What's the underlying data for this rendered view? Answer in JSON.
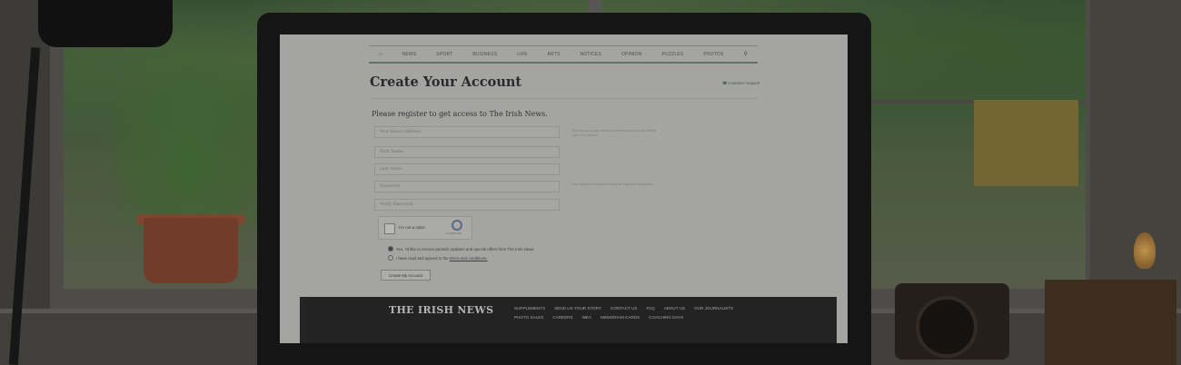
{
  "nav": {
    "items": [
      "NEWS",
      "SPORT",
      "BUSINESS",
      "LIFE",
      "ARTS",
      "NOTICES",
      "OPINION",
      "PUZZLES",
      "PHOTOS"
    ],
    "home_icon": "home-icon",
    "search_icon": "search-icon"
  },
  "header": {
    "title": "Create Your Account",
    "support_link": "Customer Support"
  },
  "form": {
    "intro": "Please register to get access to The Irish News.",
    "email_placeholder": "Your Email Address",
    "first_name_placeholder": "First Name",
    "last_name_placeholder": "Last Name",
    "password_placeholder": "Password",
    "verify_password_placeholder": "Verify Password",
    "email_hint": "We'll send you an email to confirm your account. Make sure it is correct!",
    "password_hint": "Your password needs to have at least five characters.",
    "captcha_label": "I'm not a robot",
    "captcha_brand": "reCAPTCHA",
    "optin_label": "Yes, I'd like to receive periodic updates and special offers from The Irish News",
    "terms_prefix": "I have read and agreed to the",
    "terms_link": "terms and conditions.",
    "submit_label": "Create My Account"
  },
  "footer": {
    "brand": "THE IRISH NEWS",
    "links_row1": [
      "SUPPLEMENTS",
      "SEND US YOUR STORY",
      "CONTACT US",
      "FAQ",
      "ABOUT US",
      "OUR JOURNALISTS"
    ],
    "links_row2": [
      "PHOTO SALES",
      "CAREERS",
      "WEA",
      "MEMORIAM CARDS",
      "COACHING DAYS"
    ]
  }
}
